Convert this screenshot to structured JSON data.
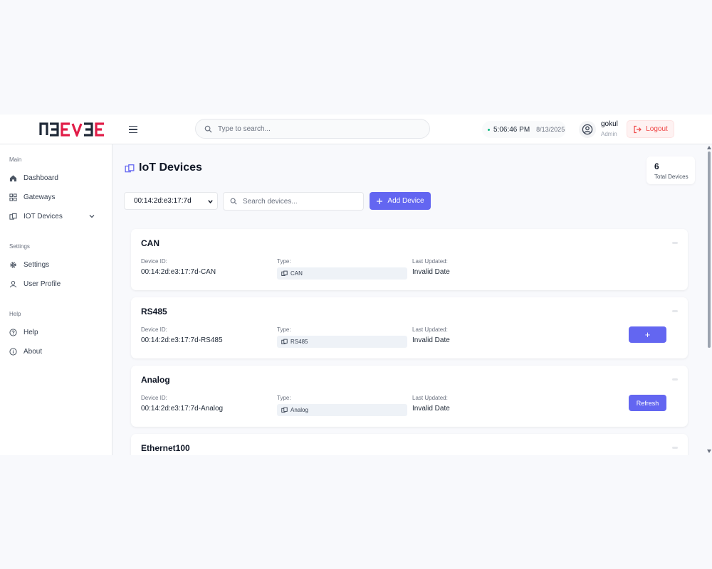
{
  "brand": {
    "logo_text": "NDEVDE",
    "accent": "#e11d48",
    "dark": "#1f2937"
  },
  "header": {
    "search_placeholder": "Type to search...",
    "time": "5:06:46 PM",
    "date": "8/13/2025",
    "user_name": "gokul",
    "user_role": "Admin",
    "logout_label": "Logout"
  },
  "sidebar": {
    "main_section": "Main",
    "settings_section": "Settings",
    "help_section": "Help",
    "items": {
      "dashboard": "Dashboard",
      "gateways": "Gateways",
      "iot_devices": "IOT Devices",
      "settings": "Settings",
      "user_profile": "User Profile",
      "help": "Help",
      "about": "About"
    }
  },
  "main": {
    "page_title": "IoT Devices",
    "total_count": "6",
    "total_label": "Total Devices",
    "gateway_selected": "00:14:2d:e3:17:7d",
    "device_search_placeholder": "Search devices...",
    "add_device_label": "Add Device",
    "labels": {
      "device_id": "Device ID:",
      "type": "Type:",
      "last_updated": "Last Updated:"
    },
    "devices": [
      {
        "name": "CAN",
        "device_id": "00:14:2d:e3:17:7d-CAN",
        "type": "CAN",
        "last_updated": "Invalid Date",
        "action": ""
      },
      {
        "name": "RS485",
        "device_id": "00:14:2d:e3:17:7d-RS485",
        "type": "RS485",
        "last_updated": "Invalid Date",
        "action": "+"
      },
      {
        "name": "Analog",
        "device_id": "00:14:2d:e3:17:7d-Analog",
        "type": "Analog",
        "last_updated": "Invalid Date",
        "action": "Refresh"
      },
      {
        "name": "Ethernet100"
      }
    ]
  },
  "colors": {
    "primary": "#6366f1",
    "danger": "#ef4444",
    "online": "#10b981"
  }
}
